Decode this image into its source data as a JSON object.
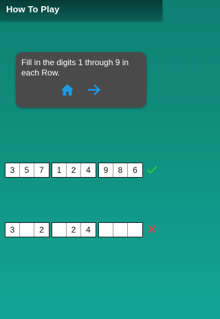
{
  "app": {
    "title": "How To Play"
  },
  "instructions": {
    "text": "Fill in the digits 1 through 9 in each Row.",
    "home_icon": "home-icon",
    "next_icon": "arrow-right-icon",
    "icon_color": "#1e9be8"
  },
  "rows": [
    {
      "groups": [
        [
          "3",
          "5",
          "7"
        ],
        [
          "1",
          "2",
          "4"
        ],
        [
          "9",
          "8",
          "6"
        ]
      ],
      "status": "valid",
      "status_icon": "check-icon",
      "status_color": "#2ecc40"
    },
    {
      "groups": [
        [
          "3",
          "",
          "2"
        ],
        [
          "",
          "2",
          "4"
        ],
        [
          "",
          "",
          ""
        ]
      ],
      "status": "invalid",
      "status_icon": "close-icon",
      "status_color": "#d64545"
    }
  ]
}
